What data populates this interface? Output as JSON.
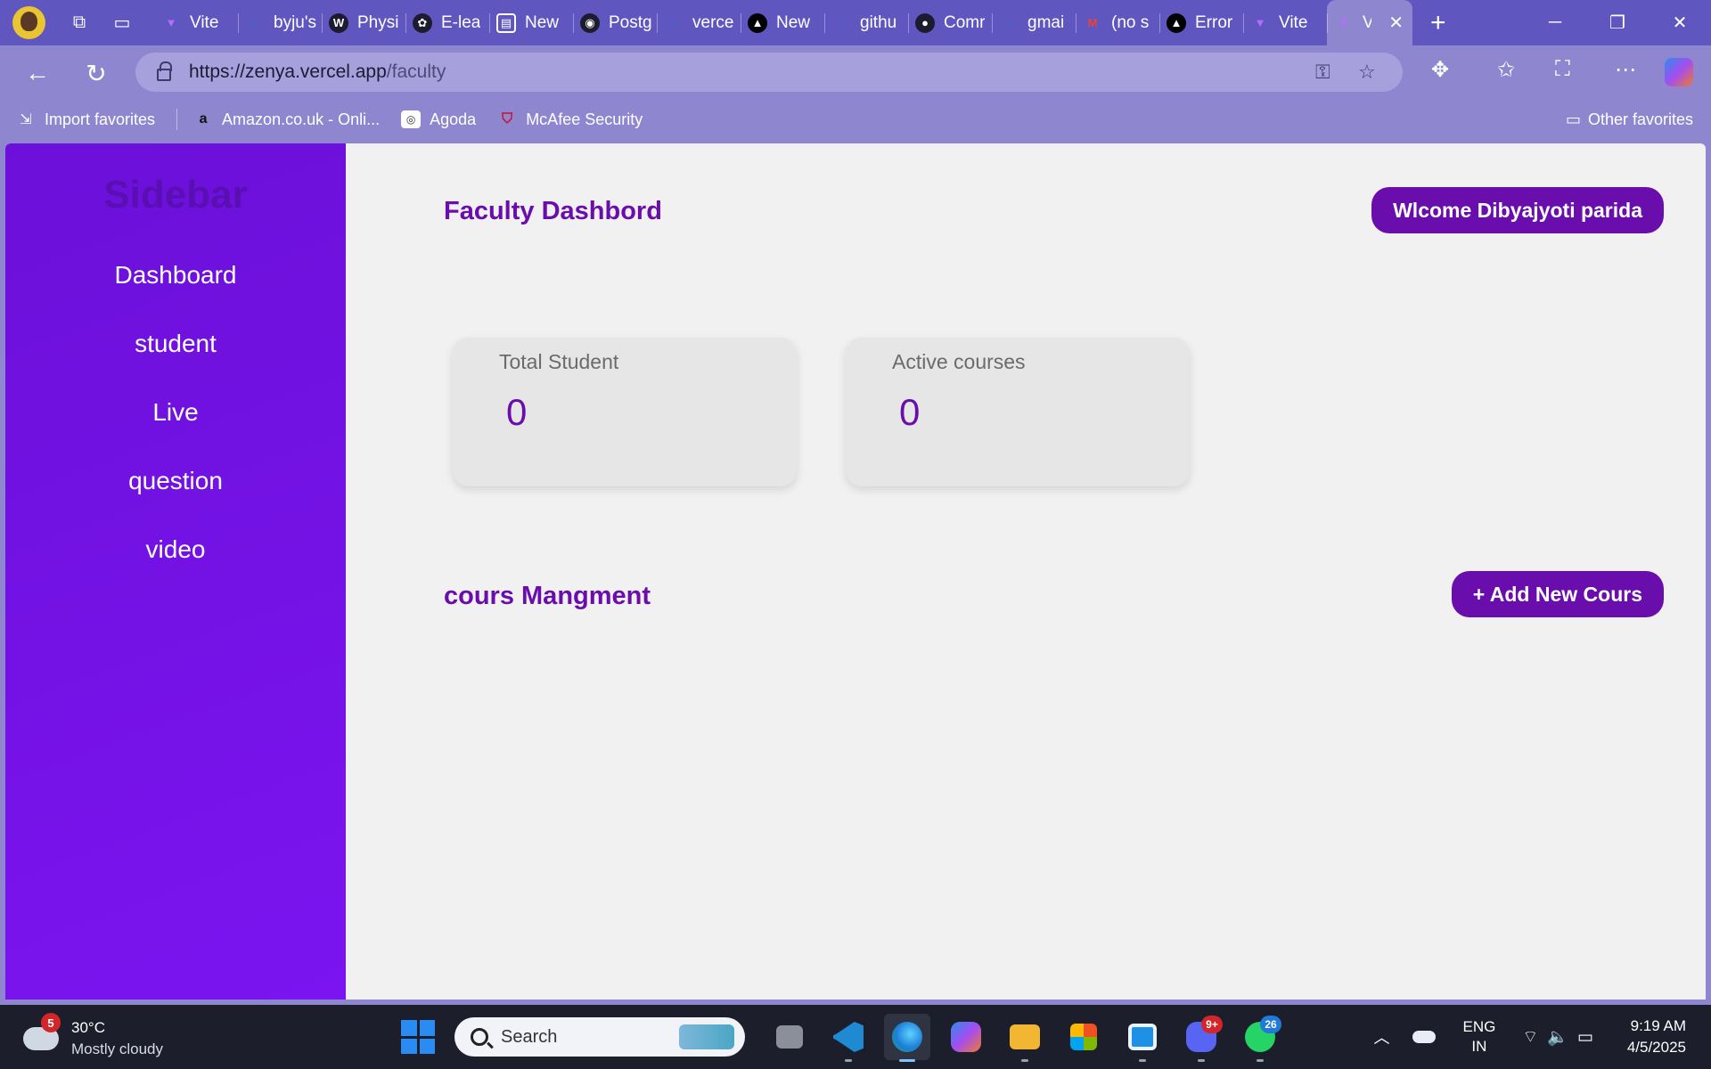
{
  "browser": {
    "tabs": [
      {
        "label": "Vite + React",
        "favicon": "vite-icon",
        "color": "#b86bff"
      },
      {
        "label": "byju's",
        "favicon": "search-icon",
        "color": "#2a6fdb"
      },
      {
        "label": "Physics",
        "favicon": "wordpress-icon",
        "color": "#1d1b2e"
      },
      {
        "label": "E-learning",
        "favicon": "openai-icon",
        "color": "#1d1b2e"
      },
      {
        "label": "New Tab",
        "favicon": "newtab-icon",
        "color": "#3a3a5a"
      },
      {
        "label": "PostgreSQL",
        "favicon": "postgres-icon",
        "color": "#1d1b2e"
      },
      {
        "label": "vercel",
        "favicon": "search-icon",
        "color": "#2a6fdb"
      },
      {
        "label": "New Project",
        "favicon": "vercel-icon",
        "color": "#000000"
      },
      {
        "label": "github",
        "favicon": "search-icon",
        "color": "#2a6fdb"
      },
      {
        "label": "Commits",
        "favicon": "github-icon",
        "color": "#1d1b2e"
      },
      {
        "label": "gmail",
        "favicon": "search-icon",
        "color": "#2a6fdb"
      },
      {
        "label": "(no subject)",
        "favicon": "gmail-icon",
        "color": "#ea4335"
      },
      {
        "label": "Error",
        "favicon": "vercel-icon",
        "color": "#000000"
      },
      {
        "label": "Vite + React",
        "favicon": "vite-icon",
        "color": "#b86bff"
      },
      {
        "label": "Vite + React",
        "favicon": "vite-icon",
        "color": "#b86bff",
        "active": true
      }
    ],
    "tab_labels_visible": [
      "Vite",
      "byju's",
      "Physi",
      "E-lea",
      "New",
      "Postg",
      "verce",
      "New",
      "githu",
      "Comr",
      "gmai",
      "(no s",
      "Error",
      "Vite",
      "V"
    ],
    "url_host": "https://zenya.vercel.app",
    "url_path": "/faculty",
    "favorites": [
      {
        "label": "Import favorites",
        "icon": "import-icon"
      },
      {
        "label": "Amazon.co.uk - Onli...",
        "icon": "amazon-icon"
      },
      {
        "label": "Agoda",
        "icon": "agoda-icon"
      },
      {
        "label": "McAfee Security",
        "icon": "mcafee-icon"
      }
    ],
    "other_favorites": "Other favorites"
  },
  "sidebar": {
    "title": "Sidebar",
    "items": [
      {
        "label": "Dashboard"
      },
      {
        "label": "student"
      },
      {
        "label": "Live"
      },
      {
        "label": "question"
      },
      {
        "label": "video"
      }
    ]
  },
  "main": {
    "title": "Faculty Dashbord",
    "welcome_label": "Wlcome Dibyajyoti parida",
    "stats": [
      {
        "label": "Total Student",
        "value": "0"
      },
      {
        "label": "Active courses",
        "value": "0"
      }
    ],
    "section_title": "cours Mangment",
    "add_button_label": "+ Add New Cours"
  },
  "taskbar": {
    "weather_temp": "30°C",
    "weather_condition": "Mostly cloudy",
    "weather_badge": "5",
    "search_placeholder": "Search",
    "discord_badge": "9+",
    "whatsapp_badge": "26",
    "lang_top": "ENG",
    "lang_bottom": "IN",
    "time": "9:19 AM",
    "date": "4/5/2025"
  },
  "colors": {
    "accent": "#6a0dad",
    "sidebar": "#7b14f0",
    "browser_frame": "#8f86d0",
    "tab_strip": "#5f56c0"
  }
}
